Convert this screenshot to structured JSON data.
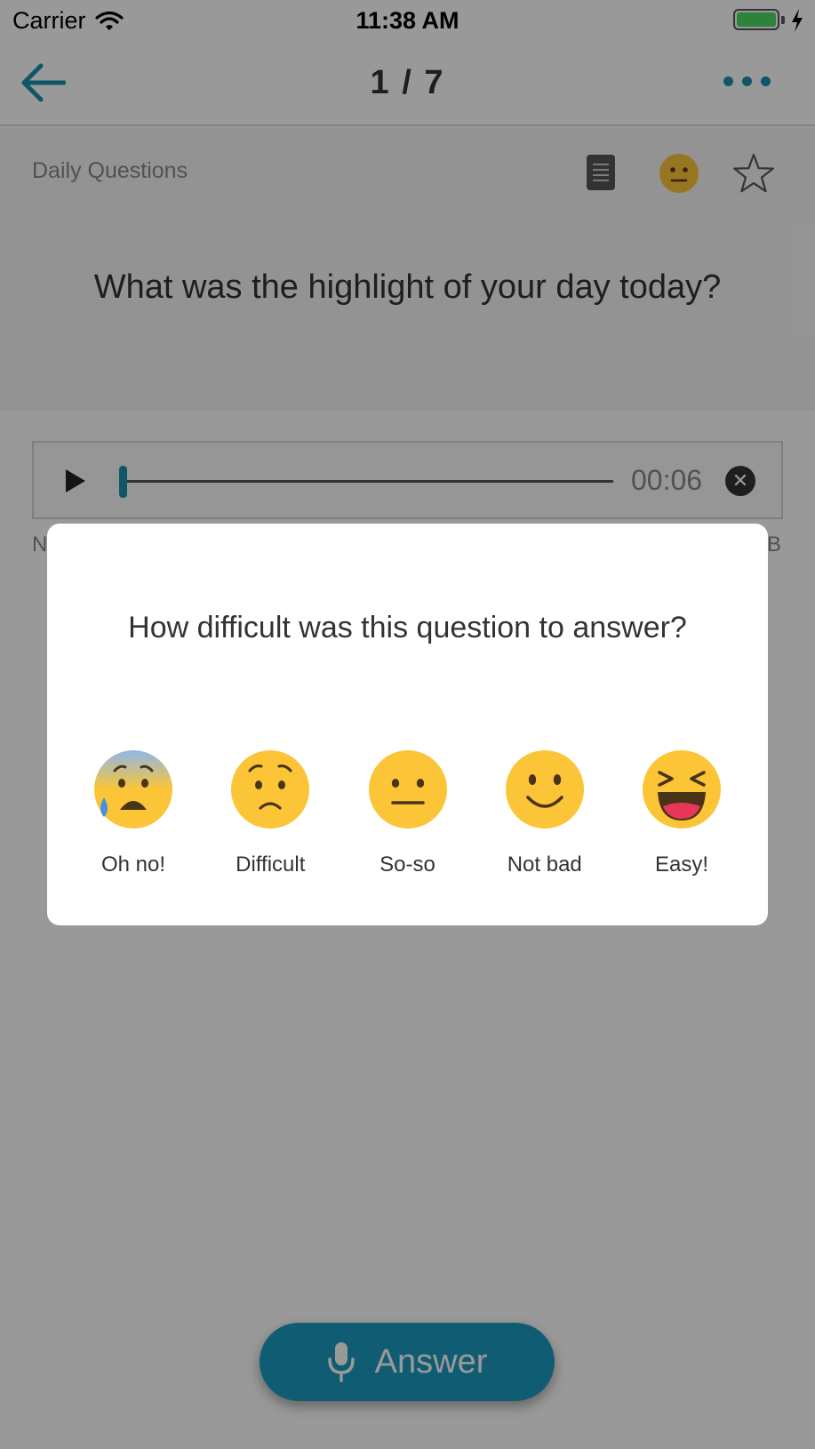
{
  "status_bar": {
    "carrier": "Carrier",
    "time": "11:38 AM"
  },
  "nav": {
    "title": "1 / 7",
    "back_icon": "arrow-left-icon",
    "more_icon": "more-dots-icon"
  },
  "question_card": {
    "category": "Daily Questions",
    "question": "What was the highlight of your day today?"
  },
  "player": {
    "time": "00:06",
    "hint_left": "N",
    "hint_right": "B"
  },
  "answer_button": {
    "label": "Answer"
  },
  "modal": {
    "question": "How difficult was this question to answer?",
    "options": [
      {
        "label": "Oh no!",
        "icon": "anxious-sweat-face-icon"
      },
      {
        "label": "Difficult",
        "icon": "worried-face-icon"
      },
      {
        "label": "So-so",
        "icon": "neutral-face-icon"
      },
      {
        "label": "Not bad",
        "icon": "slight-smile-face-icon"
      },
      {
        "label": "Easy!",
        "icon": "laughing-face-icon"
      }
    ]
  },
  "colors": {
    "accent": "#1a8fb0",
    "emoji_yellow": "#fcc537",
    "overlay": "rgba(0,0,0,0.4)"
  }
}
